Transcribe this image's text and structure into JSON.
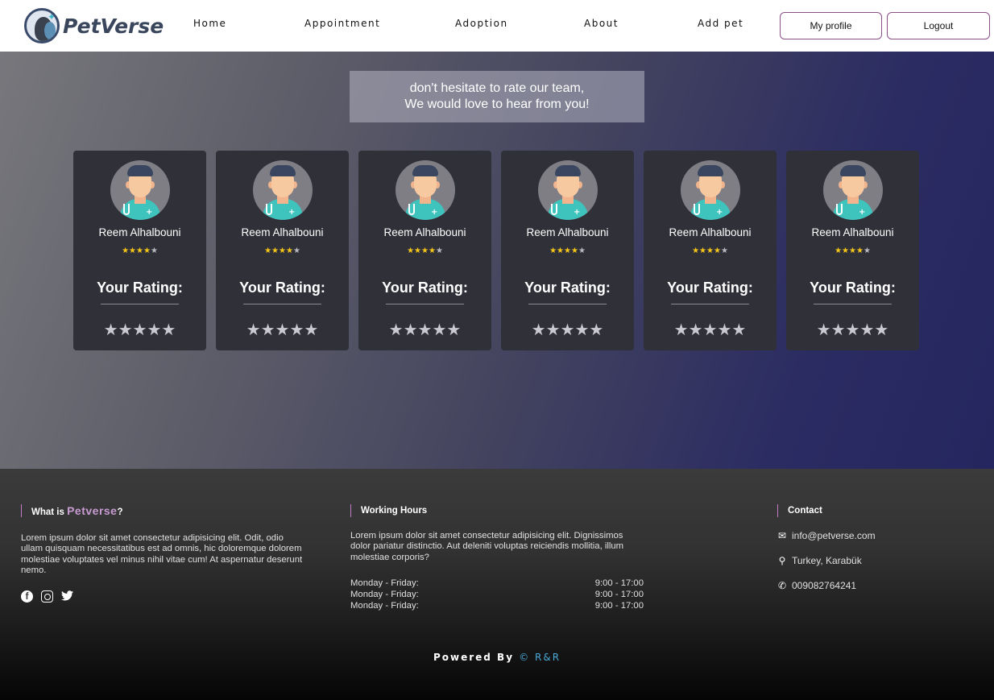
{
  "brand": {
    "name": "PetVerse"
  },
  "nav": {
    "links": [
      "Home",
      "Appointment",
      "Adoption",
      "About",
      "Add pet"
    ],
    "profile_button": "My profile",
    "logout_button": "Logout"
  },
  "hero": {
    "banner_line1": "don't hesitate to rate our team,",
    "banner_line2": "We would love to hear from you!"
  },
  "cards": [
    {
      "name": "Reem Alhalbouni",
      "rating": 4,
      "max": 5,
      "your_rating_label": "Your Rating:"
    },
    {
      "name": "Reem Alhalbouni",
      "rating": 4,
      "max": 5,
      "your_rating_label": "Your Rating:"
    },
    {
      "name": "Reem Alhalbouni",
      "rating": 4,
      "max": 5,
      "your_rating_label": "Your Rating:"
    },
    {
      "name": "Reem Alhalbouni",
      "rating": 4,
      "max": 5,
      "your_rating_label": "Your Rating:"
    },
    {
      "name": "Reem Alhalbouni",
      "rating": 4,
      "max": 5,
      "your_rating_label": "Your Rating:"
    },
    {
      "name": "Reem Alhalbouni",
      "rating": 4,
      "max": 5,
      "your_rating_label": "Your Rating:"
    }
  ],
  "footer": {
    "about": {
      "heading_prefix": "What is ",
      "heading_brand": "Petverse",
      "heading_suffix": "?",
      "text": "Lorem ipsum dolor sit amet consectetur adipisicing elit. Odit, odio ullam quisquam necessitatibus est ad omnis, hic doloremque dolorem molestiae voluptates vel minus nihil vitae cum! At aspernatur deserunt nemo."
    },
    "hours": {
      "heading": "Working Hours",
      "text": "Lorem ipsum dolor sit amet consectetur adipisicing elit. Dignissimos dolor pariatur distinctio. Aut deleniti voluptas reiciendis mollitia, illum molestiae corporis?",
      "rows": [
        {
          "day": "Monday - Friday:",
          "time": "9:00 - 17:00"
        },
        {
          "day": "Monday - Friday:",
          "time": "9:00 - 17:00"
        },
        {
          "day": "Monday - Friday:",
          "time": "9:00 - 17:00"
        }
      ]
    },
    "contact": {
      "heading": "Contact",
      "email": "info@petverse.com",
      "location": "Turkey, Karabük",
      "phone": "009082764241"
    },
    "powered_prefix": "Powered By ",
    "powered_brand": "© R&R"
  },
  "colors": {
    "star_filled": "#f5c518",
    "accent_purple": "#c27bc4",
    "accent_blue": "#4aa9d6"
  }
}
